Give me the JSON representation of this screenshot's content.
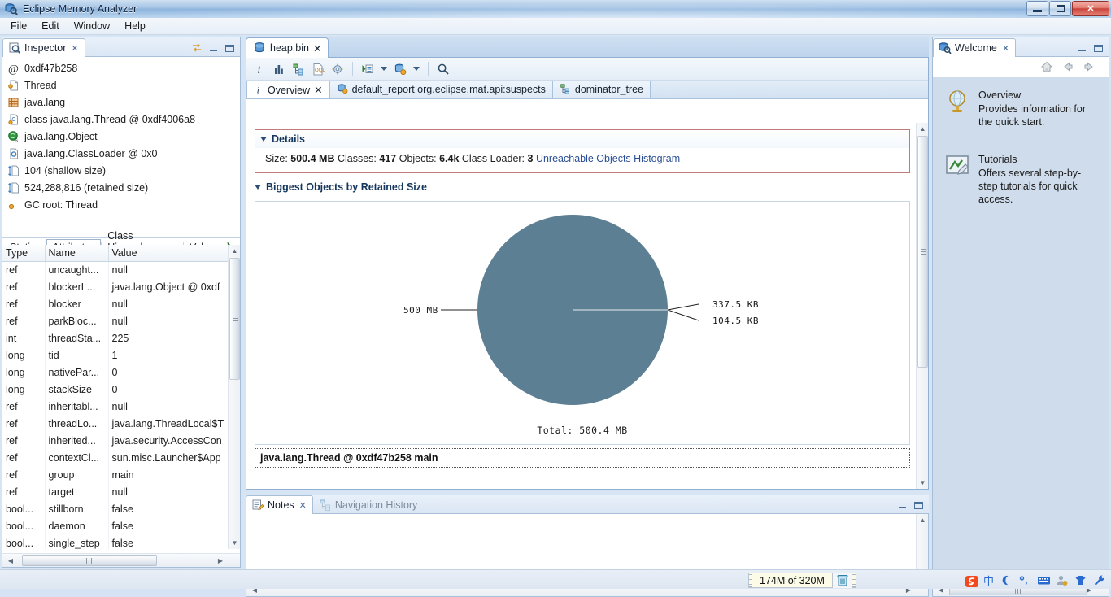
{
  "window": {
    "title": "Eclipse Memory Analyzer",
    "icon": "memory-analyzer-icon",
    "minimize_label": "",
    "maximize_label": "",
    "close_label": "✕"
  },
  "menubar": {
    "items": [
      {
        "label": "File"
      },
      {
        "label": "Edit"
      },
      {
        "label": "Window"
      },
      {
        "label": "Help"
      }
    ]
  },
  "inspector": {
    "tab_label": "Inspector",
    "tab_icon": "inspector-icon",
    "close_glyph": "✕",
    "tools": {
      "link_icon": "link-with-editor-icon",
      "minimize_icon": "minimize-icon",
      "maximize_icon": "maximize-icon"
    },
    "entries": [
      {
        "icon": "at-icon",
        "label": "0xdf47b258"
      },
      {
        "icon": "class-file-icon",
        "label": "Thread"
      },
      {
        "icon": "package-icon",
        "label": "java.lang"
      },
      {
        "icon": "class-icon",
        "label": "class java.lang.Thread @ 0xdf4006a8"
      },
      {
        "icon": "superclass-icon",
        "label": "java.lang.Object"
      },
      {
        "icon": "classloader-icon",
        "label": "java.lang.ClassLoader @ 0x0"
      },
      {
        "icon": "shallow-size-icon",
        "label": "104 (shallow size)"
      },
      {
        "icon": "retained-size-icon",
        "label": "524,288,816 (retained size)"
      },
      {
        "icon": "gc-root-icon",
        "label": "GC root: Thread"
      }
    ],
    "tabs": [
      {
        "label": "Statics",
        "selected": false
      },
      {
        "label": "Attributes",
        "selected": true
      },
      {
        "label": "Class Hierarchy",
        "selected": false
      },
      {
        "label": "Value",
        "selected": false
      }
    ],
    "pin_icon": "pin-icon",
    "table": {
      "columns": [
        "Type",
        "Name",
        "Value"
      ],
      "rows": [
        [
          "ref",
          "uncaught...",
          "null"
        ],
        [
          "ref",
          "blockerL...",
          "java.lang.Object @ 0xdf"
        ],
        [
          "ref",
          "blocker",
          "null"
        ],
        [
          "ref",
          "parkBloc...",
          "null"
        ],
        [
          "int",
          "threadSta...",
          "225"
        ],
        [
          "long",
          "tid",
          "1"
        ],
        [
          "long",
          "nativePar...",
          "0"
        ],
        [
          "long",
          "stackSize",
          "0"
        ],
        [
          "ref",
          "inheritabl...",
          "null"
        ],
        [
          "ref",
          "threadLo...",
          "java.lang.ThreadLocal$T"
        ],
        [
          "ref",
          "inherited...",
          "java.security.AccessCon"
        ],
        [
          "ref",
          "contextCl...",
          "sun.misc.Launcher$App"
        ],
        [
          "ref",
          "group",
          "main"
        ],
        [
          "ref",
          "target",
          "null"
        ],
        [
          "bool...",
          "stillborn",
          "false"
        ],
        [
          "bool...",
          "daemon",
          "false"
        ],
        [
          "bool...",
          "single_step",
          "false"
        ]
      ]
    }
  },
  "editor": {
    "tab_label": "heap.bin",
    "tab_icon": "heap-dump-icon",
    "close_glyph": "✕",
    "toolbar": [
      {
        "icon": "overview-info-icon",
        "label": "i"
      },
      {
        "icon": "histogram-icon",
        "label": ""
      },
      {
        "icon": "dominator-tree-icon",
        "label": ""
      },
      {
        "icon": "oql-icon",
        "label": "OQL"
      },
      {
        "icon": "gear-icon",
        "label": ""
      },
      {
        "icon": "run-expert-system-icon",
        "label": ""
      },
      {
        "icon": "chevron-down-icon",
        "label": ""
      },
      {
        "icon": "query-browser-icon",
        "label": ""
      },
      {
        "icon": "chevron-down-icon",
        "label": ""
      },
      {
        "icon": "search-icon",
        "label": ""
      }
    ],
    "page_tabs": [
      {
        "label": "Overview",
        "icon": "overview-info-icon",
        "active": true,
        "closeable": true
      },
      {
        "label": "default_report org.eclipse.mat.api:suspects",
        "icon": "report-icon",
        "active": false,
        "closeable": false
      },
      {
        "label": "dominator_tree",
        "icon": "dominator-tree-icon",
        "active": false,
        "closeable": false
      }
    ],
    "details": {
      "title": "Details",
      "size_label": "Size:",
      "size_value": "500.4 MB",
      "classes_label": "Classes:",
      "classes_value": "417",
      "objects_label": "Objects:",
      "objects_value": "6.4k",
      "classloader_label": "Class Loader:",
      "classloader_value": "3",
      "link": "Unreachable Objects Histogram"
    },
    "biggest_objects": {
      "title": "Biggest Objects by Retained Size"
    },
    "selected_object": "java.lang.Thread @ 0xdf47b258 main"
  },
  "chart_data": {
    "type": "pie",
    "title": "Biggest Objects by Retained Size",
    "total_label": "Total: 500.4 MB",
    "labels": [
      "500 MB",
      "337.5 KB",
      "104.5 KB"
    ],
    "values": [
      500.0,
      0.3295,
      0.102
    ],
    "units": "MB",
    "colors": [
      "#5d7f93",
      "#5d7f93",
      "#5d7f93"
    ],
    "legend": "none",
    "grid": false,
    "label_positions": [
      "left",
      "right-upper",
      "right-lower"
    ]
  },
  "notes": {
    "tabs": [
      {
        "label": "Notes",
        "icon": "notes-icon",
        "active": true,
        "closeable": true
      },
      {
        "label": "Navigation History",
        "icon": "navigation-history-icon",
        "active": false,
        "closeable": false
      }
    ],
    "content": ""
  },
  "welcome": {
    "tab_label": "Welcome",
    "tab_icon": "welcome-icon",
    "close_glyph": "✕",
    "nav": {
      "home_icon": "home-icon",
      "back_icon": "back-arrow-icon",
      "forward_icon": "forward-arrow-icon"
    },
    "items": [
      {
        "icon": "overview-globe-icon",
        "title": "Overview",
        "description": "Provides information for the quick start."
      },
      {
        "icon": "tutorials-icon",
        "title": "Tutorials",
        "description": "Offers several step-by-step tutorials for quick access."
      }
    ]
  },
  "statusbar": {
    "heap_usage": "174M of 320M",
    "trash_icon": "trash-icon",
    "ime": {
      "logo": "sogou-ime-logo",
      "items": [
        "中",
        "moon-icon",
        "degree-comma-icon",
        "keyboard-icon",
        "user-icon",
        "skin-icon",
        "wrench-icon"
      ]
    }
  },
  "colors": {
    "accent": "#2a4f96",
    "pie_fill": "#5d7f93",
    "details_border": "#c07b7b",
    "section_title": "#14365c"
  }
}
